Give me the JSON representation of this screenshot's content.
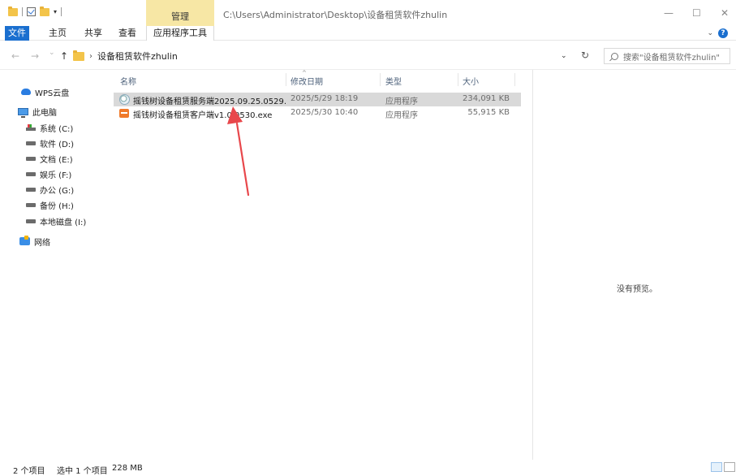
{
  "titlebar": {
    "manage_tab": "管理",
    "path": "C:\\Users\\Administrator\\Desktop\\设备租赁软件zhulin",
    "minimize": "—",
    "maximize": "☐",
    "close": "✕"
  },
  "ribbon": {
    "tabs": [
      "文件",
      "主页",
      "共享",
      "查看",
      "应用程序工具"
    ],
    "expand_icon": "chevron-down-icon",
    "help_label": "?"
  },
  "address": {
    "back": "←",
    "forward": "→",
    "recent": "⌄",
    "up": "↑",
    "current_folder": "设备租赁软件zhulin",
    "dropdown": "⌄",
    "refresh": "↻",
    "search_placeholder": "搜索\"设备租赁软件zhulin\""
  },
  "sidebar": {
    "items": [
      {
        "label": "WPS云盘",
        "icon": "cloud-icon"
      },
      {
        "label": "此电脑",
        "icon": "computer-icon"
      },
      {
        "label": "系统 (C:)",
        "icon": "system-drive-icon"
      },
      {
        "label": "软件 (D:)",
        "icon": "drive-icon"
      },
      {
        "label": "文档 (E:)",
        "icon": "drive-icon"
      },
      {
        "label": "娱乐 (F:)",
        "icon": "drive-icon"
      },
      {
        "label": "办公 (G:)",
        "icon": "drive-icon"
      },
      {
        "label": "备份 (H:)",
        "icon": "drive-icon"
      },
      {
        "label": "本地磁盘 (I:)",
        "icon": "drive-icon"
      },
      {
        "label": "网络",
        "icon": "network-icon"
      }
    ]
  },
  "columns": {
    "name": "名称",
    "modified": "修改日期",
    "type": "类型",
    "size": "大小",
    "sort_indicator": "^"
  },
  "files": [
    {
      "name": "摇钱树设备租赁服务端2025.09.25.0529....",
      "modified": "2025/5/29 18:19",
      "type": "应用程序",
      "size": "234,091 KB",
      "selected": true,
      "icon": "server-app-icon"
    },
    {
      "name": "摇钱树设备租赁客户端v1.0.0530.exe",
      "modified": "2025/5/30 10:40",
      "type": "应用程序",
      "size": "55,915 KB",
      "selected": false,
      "icon": "client-app-icon"
    }
  ],
  "annotation": {
    "color": "#e8474b"
  },
  "preview": {
    "empty_text": "没有预览。"
  },
  "status": {
    "item_count": "2 个项目",
    "selection": "选中 1 个项目",
    "selection_size": "228 MB"
  },
  "colors": {
    "accent": "#1a6fcf",
    "manage_tab": "#f7e7a5",
    "selection": "#d9d9d9"
  }
}
